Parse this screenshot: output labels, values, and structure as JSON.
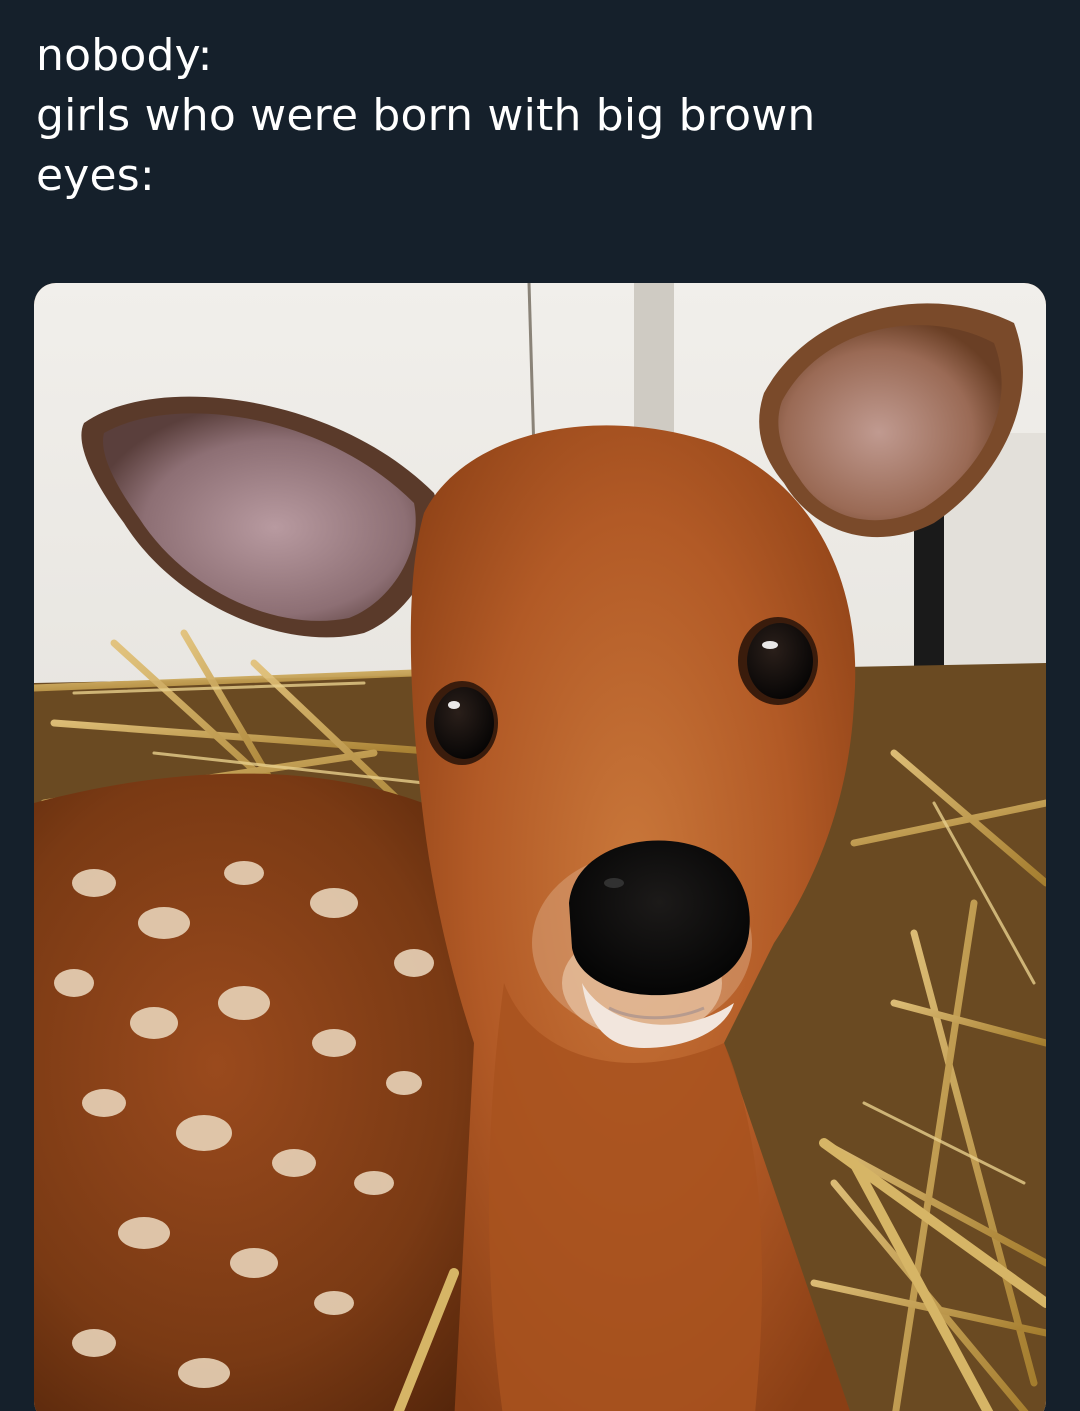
{
  "tweet": {
    "lines": [
      "nobody:",
      "girls who were born with big brown",
      "eyes:"
    ]
  },
  "media": {
    "alt": ""
  },
  "colors": {
    "background": "#15202b",
    "text": "#ffffff",
    "fur": "#b25a26",
    "fur_dark": "#7a3a14",
    "spots": "#e8d3b8",
    "hay": "#c9a24e",
    "wall": "#e6e3de"
  }
}
